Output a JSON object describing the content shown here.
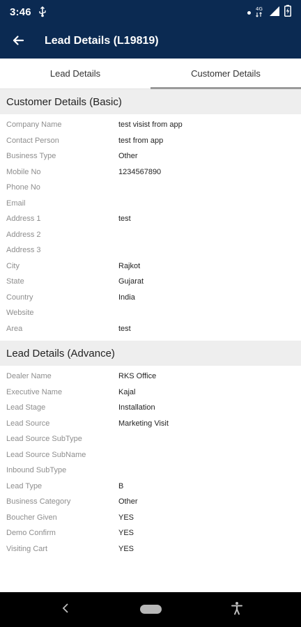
{
  "status_bar": {
    "time": "3:46",
    "icons": [
      "usb-icon",
      "notification-dot-icon",
      "4g-lte-icon",
      "signal-icon",
      "battery-charging-icon"
    ]
  },
  "app_bar": {
    "title": "Lead Details (L19819)",
    "back_icon": "arrow-left-icon"
  },
  "tabs": [
    {
      "label": "Lead Details",
      "active": false
    },
    {
      "label": "Customer Details",
      "active": true
    }
  ],
  "customer_basic": {
    "header": "Customer Details (Basic)",
    "rows": [
      {
        "label": "Company Name",
        "value": "test visist from app"
      },
      {
        "label": "Contact Person",
        "value": "test from app"
      },
      {
        "label": "Business Type",
        "value": "Other"
      },
      {
        "label": "Mobile No",
        "value": "1234567890"
      },
      {
        "label": "Phone No",
        "value": ""
      },
      {
        "label": "Email",
        "value": ""
      },
      {
        "label": "Address 1",
        "value": "test"
      },
      {
        "label": "Address 2",
        "value": ""
      },
      {
        "label": "Address 3",
        "value": ""
      },
      {
        "label": "City",
        "value": "Rajkot"
      },
      {
        "label": "State",
        "value": "Gujarat"
      },
      {
        "label": "Country",
        "value": "India"
      },
      {
        "label": "Website",
        "value": ""
      },
      {
        "label": "Area",
        "value": "test"
      }
    ]
  },
  "lead_advance": {
    "header": "Lead Details (Advance)",
    "rows": [
      {
        "label": "Dealer Name",
        "value": "RKS Office"
      },
      {
        "label": "Executive Name",
        "value": "Kajal"
      },
      {
        "label": "Lead Stage",
        "value": "Installation"
      },
      {
        "label": "Lead Source",
        "value": "Marketing Visit"
      },
      {
        "label": "Lead Source SubType",
        "value": ""
      },
      {
        "label": "Lead Source SubName",
        "value": ""
      },
      {
        "label": "Inbound SubType",
        "value": ""
      },
      {
        "label": "Lead Type",
        "value": "B"
      },
      {
        "label": "Business Category",
        "value": "Other"
      },
      {
        "label": "Boucher Given",
        "value": "YES"
      },
      {
        "label": "Demo Confirm",
        "value": "YES"
      },
      {
        "label": "Visiting Cart",
        "value": "YES"
      }
    ]
  },
  "nav_bar": {
    "icons": [
      "nav-back-icon",
      "home-pill-icon",
      "accessibility-icon"
    ]
  },
  "colors": {
    "primary": "#0b2a52",
    "section_bg": "#eeeeee",
    "label": "#8e8e8e",
    "tab_indicator": "#9a9a9a"
  }
}
